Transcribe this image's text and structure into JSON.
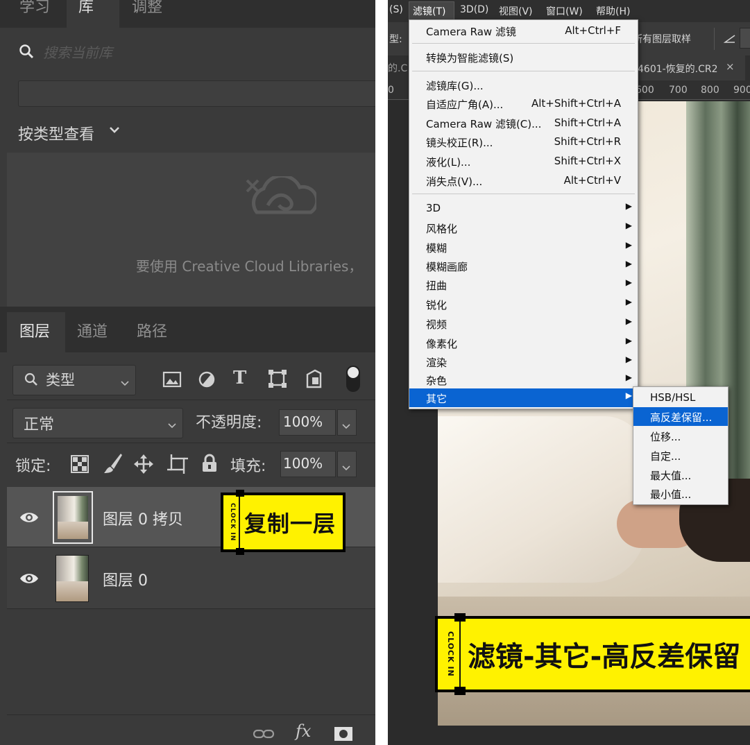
{
  "left": {
    "top_tabs": [
      "学习",
      "库",
      "调整"
    ],
    "search_placeholder": "搜索当前库",
    "view_by_type": "按类型查看",
    "cc_message": "要使用 Creative Cloud Libraries，",
    "panel_tabs": [
      "图层",
      "通道",
      "路径"
    ],
    "filter_kind": "类型",
    "blend_mode": "正常",
    "opacity_label": "不透明度:",
    "opacity_value": "100%",
    "lock_label": "锁定:",
    "fill_label": "填充:",
    "fill_value": "100%",
    "layers": [
      {
        "name": "图层 0 拷贝"
      },
      {
        "name": "图层 0"
      }
    ],
    "sticker_top": {
      "clock": "CLOCK IN",
      "text": "复制一层"
    },
    "bottom_fx": "fx"
  },
  "right": {
    "menubar": [
      "(S)",
      "滤镜(T)",
      "3D(D)",
      "视图(V)",
      "窗口(W)",
      "帮助(H)"
    ],
    "options_left": "型:",
    "options_right": "所有图层取样",
    "doc_tabs": [
      "的.C",
      "4601-恢复的.CR2"
    ],
    "doc_close": "×",
    "ruler_marks": [
      "0",
      "600",
      "700",
      "800",
      "900"
    ],
    "menu": {
      "group1": [
        {
          "label": "Camera Raw 滤镜",
          "shortcut": "Alt+Ctrl+F"
        }
      ],
      "group2": [
        {
          "label": "转换为智能滤镜(S)",
          "shortcut": ""
        }
      ],
      "group3": [
        {
          "label": "滤镜库(G)...",
          "shortcut": ""
        },
        {
          "label": "自适应广角(A)...",
          "shortcut": "Alt+Shift+Ctrl+A"
        },
        {
          "label": "Camera Raw 滤镜(C)...",
          "shortcut": "Shift+Ctrl+A"
        },
        {
          "label": "镜头校正(R)...",
          "shortcut": "Shift+Ctrl+R"
        },
        {
          "label": "液化(L)...",
          "shortcut": "Shift+Ctrl+X"
        },
        {
          "label": "消失点(V)...",
          "shortcut": "Alt+Ctrl+V"
        }
      ],
      "group4": [
        {
          "label": "3D"
        },
        {
          "label": "风格化"
        },
        {
          "label": "模糊"
        },
        {
          "label": "模糊画廊"
        },
        {
          "label": "扭曲"
        },
        {
          "label": "锐化"
        },
        {
          "label": "视频"
        },
        {
          "label": "像素化"
        },
        {
          "label": "渲染"
        },
        {
          "label": "杂色"
        },
        {
          "label": "其它"
        }
      ]
    },
    "submenu": [
      "HSB/HSL",
      "高反差保留...",
      "位移...",
      "自定...",
      "最大值...",
      "最小值..."
    ],
    "sticker_bottom": {
      "clock": "CLOCK IN",
      "text": "滤镜-其它-高反差保留"
    }
  },
  "colors": {
    "highlight": "#0a64d2",
    "sticker": "#fff200",
    "panel": "#3a3a3a"
  }
}
